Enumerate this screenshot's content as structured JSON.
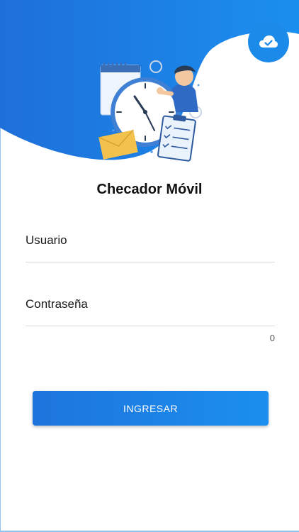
{
  "app": {
    "title": "Checador Móvil"
  },
  "form": {
    "username_placeholder": "Usuario",
    "password_placeholder": "Contraseña",
    "password_counter": "0"
  },
  "actions": {
    "login_label": "INGRESAR"
  },
  "icons": {
    "sync": "cloud-check-icon"
  },
  "colors": {
    "primary": "#1c8ae8",
    "button_start": "#1e74dc",
    "button_end": "#1b8ff0"
  }
}
